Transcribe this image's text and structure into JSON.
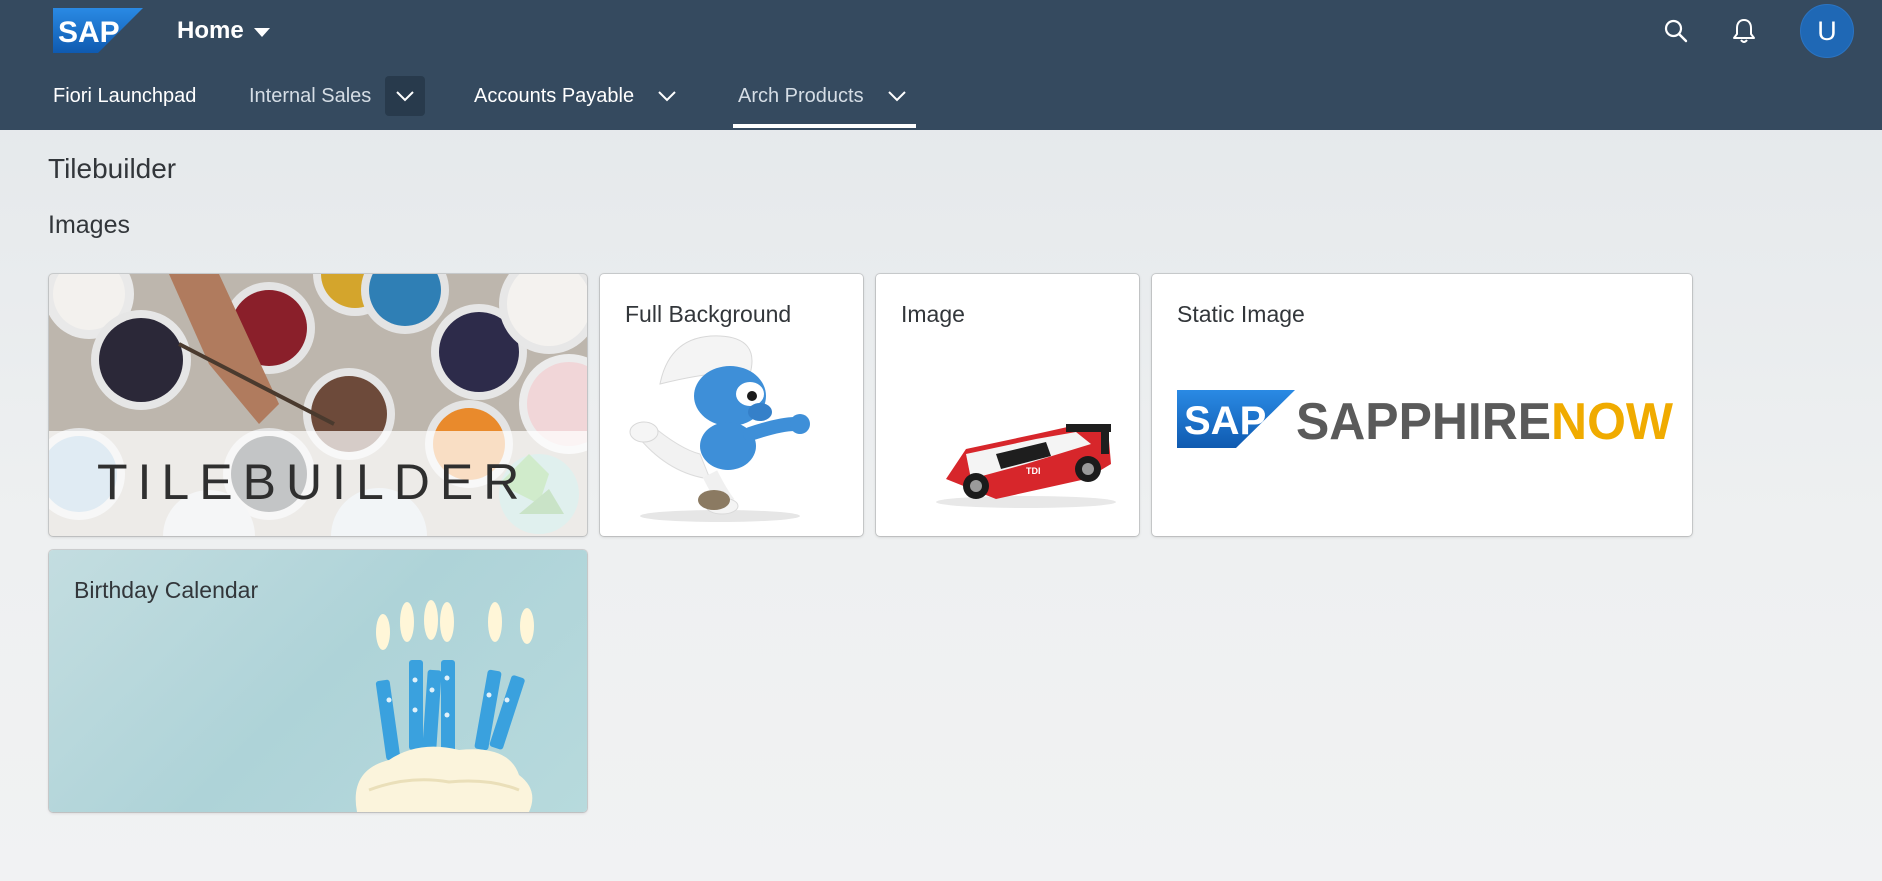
{
  "shell": {
    "home_label": "Home",
    "avatar_initial": "U",
    "icons": [
      "search-icon",
      "bell-icon"
    ]
  },
  "nav": {
    "items": [
      {
        "label": "Fiori Launchpad"
      },
      {
        "label": "Internal Sales"
      },
      {
        "label": "Accounts Payable"
      },
      {
        "label": "Arch Products"
      }
    ],
    "active": "Arch Products"
  },
  "page": {
    "title": "Tilebuilder",
    "group_title": "Images"
  },
  "tiles": {
    "tilebuilder": {
      "word": "TILEBUILDER"
    },
    "full_background": {
      "title": "Full Background"
    },
    "image": {
      "title": "Image"
    },
    "static_image": {
      "title": "Static Image",
      "brand_main": "SAPPHIRE",
      "brand_accent": "NOW"
    },
    "birthday": {
      "title": "Birthday Calendar"
    }
  },
  "colors": {
    "shell_bg": "#354a5f",
    "sap_blue": "#1f6fc5",
    "now_gold": "#f0ab00",
    "sapphire_gray": "#5a5a5a"
  }
}
